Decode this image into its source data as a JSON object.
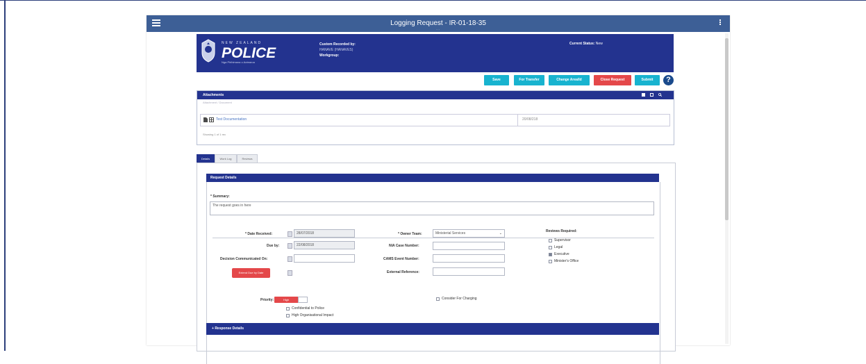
{
  "window": {
    "title": "Logging Request - IR-01-18-35",
    "subtitle": "..."
  },
  "header": {
    "logo": {
      "line1": "NEW ZEALAND",
      "line2": "POLICE",
      "tagline": "Nga Pirihimana o Aotearoa"
    },
    "logged_by_label": "Custom Recorded by:",
    "logged_by_value": "HANAVE (HANAVES)",
    "workgroup_label": "Workgroup:",
    "status_label": "Current Status:",
    "status_value": "New"
  },
  "toolbar": {
    "save": "Save",
    "for_transfer": "For Transfer",
    "change_area": "Change Area/Id",
    "close_request": "Close Request",
    "submit": "Submit",
    "help": "?"
  },
  "attachments": {
    "title": "Attachments",
    "dropdown_text": "Attachment / Document",
    "file_name": "Test Documentation",
    "file_meta": "20/08/218",
    "showing": "Showing 1 of 1 rec"
  },
  "tabs": [
    {
      "label": "Details"
    },
    {
      "label": "Work Log"
    },
    {
      "label": "Reviews"
    }
  ],
  "request_details": {
    "title": "Request Details",
    "summary_label": "* Summary:",
    "summary_value": "The request goes in here",
    "date_received_label": "* Date Received:",
    "date_received_value": "28/07/2018",
    "due_by_label": "Due by:",
    "due_by_value": "22/08/2018",
    "decision_label": "Decision Communicated On:",
    "extend_button": "Extend Due by Date",
    "owner_team_label": "* Owner Team:",
    "owner_team_value": "Ministerial Services",
    "nia_label": "NIA Case Number:",
    "cams_label": "CAMS Event Number:",
    "external_label": "External Reference:",
    "reviews_label": "Reviews Required:",
    "reviews": [
      {
        "label": "Supervisor",
        "checked": false
      },
      {
        "label": "Legal",
        "checked": false
      },
      {
        "label": "Executive",
        "checked": true
      },
      {
        "label": "Minister's Office",
        "checked": false
      }
    ],
    "priority_label": "Priority:",
    "priority_value": "High",
    "confidential_label": "Confidential to Police",
    "org_impact_label": "High Organisational Impact",
    "consider_charging_label": "Consider For Charging"
  },
  "response_details": {
    "title": "Response Details",
    "prefix": "+"
  },
  "colors": {
    "navy": "#23338f",
    "titlebar": "#3d5f96",
    "teal": "#18b3cf",
    "red": "#e4484a"
  }
}
